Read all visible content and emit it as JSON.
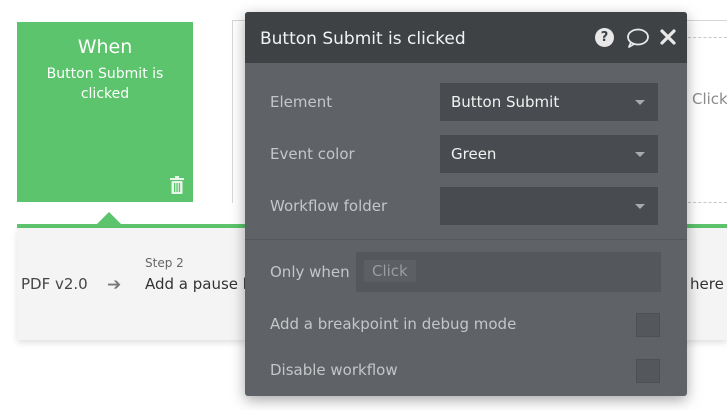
{
  "event": {
    "heading": "When",
    "description": "Button Submit is clicked"
  },
  "canvas": {
    "right_click_text": "Click",
    "right_here_text": "here"
  },
  "steps": {
    "previous_label": "PDF v2.0",
    "step_number": "Step 2",
    "step_title": "Add a pause b"
  },
  "panel": {
    "title": "Button Submit is clicked",
    "help_glyph": "?",
    "element_label": "Element",
    "element_value": "Button Submit",
    "event_color_label": "Event color",
    "event_color_value": "Green",
    "workflow_folder_label": "Workflow folder",
    "workflow_folder_value": "",
    "only_when_label": "Only when",
    "only_when_placeholder": "Click",
    "breakpoint_label": "Add a breakpoint in debug mode",
    "disable_label": "Disable workflow"
  },
  "colors": {
    "event_green": "#5cc46c",
    "panel_bg": "#5f6266",
    "panel_header": "#3f4245"
  },
  "icons": [
    "trash-icon",
    "arrow-right-icon",
    "help-icon",
    "comment-icon",
    "close-icon",
    "chevron-down-icon"
  ]
}
